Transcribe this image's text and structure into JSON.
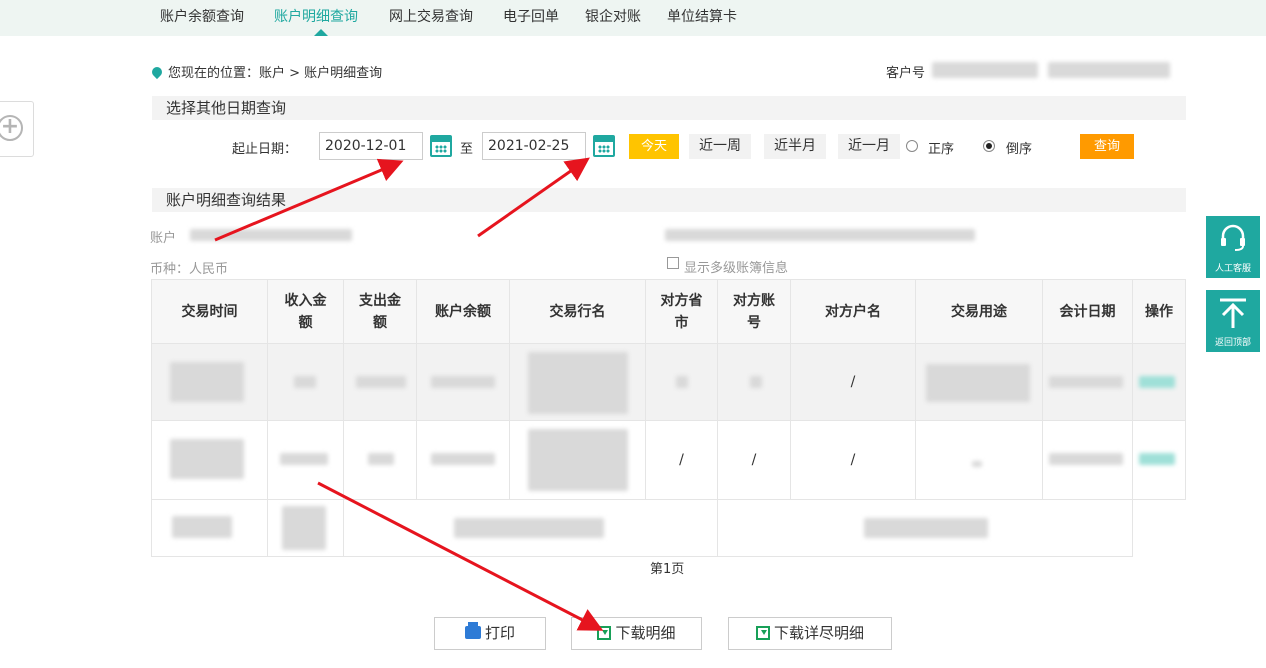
{
  "top_tabs": [
    {
      "label": "账户余额查询"
    },
    {
      "label": "账户明细查询"
    },
    {
      "label": "网上交易查询"
    },
    {
      "label": "电子回单"
    },
    {
      "label": "银企对账"
    },
    {
      "label": "单位结算卡"
    }
  ],
  "breadcrumb": "您现在的位置：账户 > 账户明细查询",
  "customer_label": "客户号",
  "section_date": "选择其他日期查询",
  "date_filter": {
    "label": "起止日期：",
    "start": "2020-12-01",
    "separator": "至",
    "end": "2021-02-25",
    "today_btn": "今天",
    "week_btn": "近一周",
    "half_month_btn": "近半月",
    "month_btn": "近一月",
    "order_asc": "正序",
    "order_desc": "倒序",
    "query_btn": "查询"
  },
  "section_result": "账户明细查询结果",
  "account_label": "账户",
  "currency_label": "币种：人民币",
  "show_multi_label": "显示多级账簿信息",
  "table": {
    "headers": [
      "交易时间",
      "收入金额",
      "支出金额",
      "账户余额",
      "交易行名",
      "对方省市",
      "对方账号",
      "对方户名",
      "交易用途",
      "会计日期",
      "操作"
    ],
    "row1_slash": "/",
    "row2_slash": "/"
  },
  "page_label": "第1页",
  "right_side": {
    "service": "人工客服",
    "top": "返回顶部"
  },
  "buttons": {
    "print": "打印",
    "download": "下载明细",
    "download_full": "下载详尽明细"
  },
  "colors": {
    "accent": "#1fa8a0",
    "yellow": "#ffc400",
    "orange": "#ff9a00",
    "arrow": "#e6141e"
  }
}
